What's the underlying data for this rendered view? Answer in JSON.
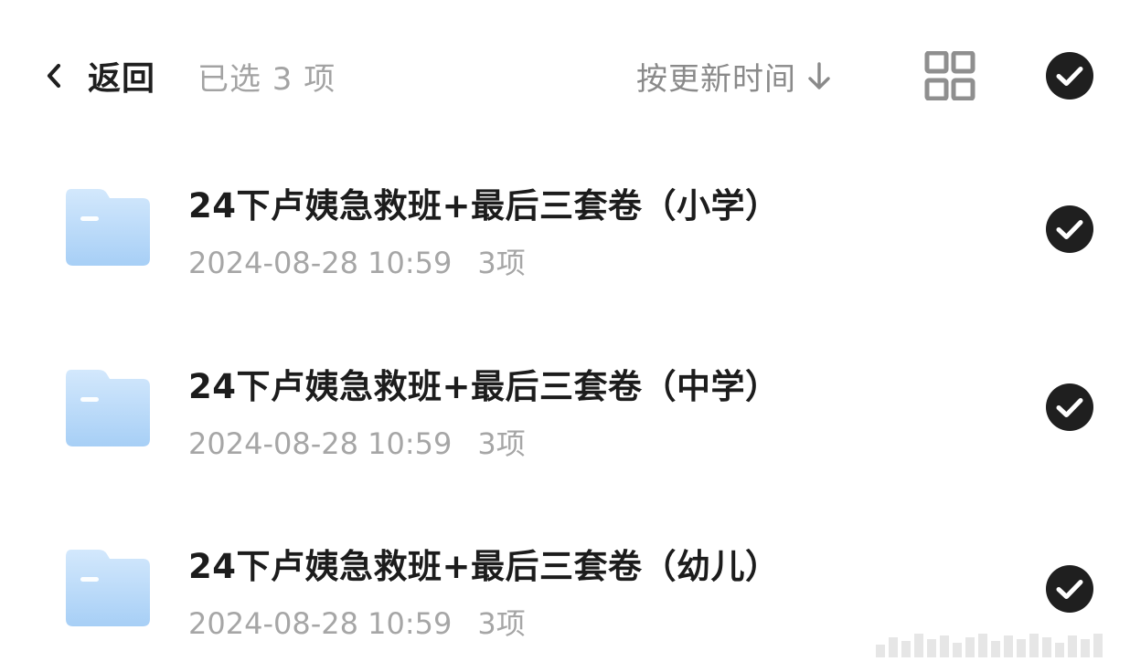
{
  "header": {
    "back_label": "返回",
    "selected_text": "已选 3 项",
    "sort_label": "按更新时间",
    "icons": {
      "back": "chevron-left-icon",
      "sort": "arrow-down-icon",
      "view": "grid-view-icon",
      "select_all": "check-circle-icon"
    }
  },
  "files": [
    {
      "name": "24下卢姨急救班+最后三套卷（小学）",
      "date": "2024-08-28 10:59",
      "count": "3项",
      "selected": true,
      "icon": "folder-icon"
    },
    {
      "name": "24下卢姨急救班+最后三套卷（中学）",
      "date": "2024-08-28 10:59",
      "count": "3项",
      "selected": true,
      "icon": "folder-icon"
    },
    {
      "name": "24下卢姨急救班+最后三套卷（幼儿）",
      "date": "2024-08-28 10:59",
      "count": "3项",
      "selected": true,
      "icon": "folder-icon"
    }
  ],
  "colors": {
    "folder_top": "#cfe6fb",
    "folder_bottom": "#a9d1f7",
    "check_fill": "#1f1f1f",
    "title_text": "#1c1c1c",
    "meta_text": "#a6a6a6"
  }
}
